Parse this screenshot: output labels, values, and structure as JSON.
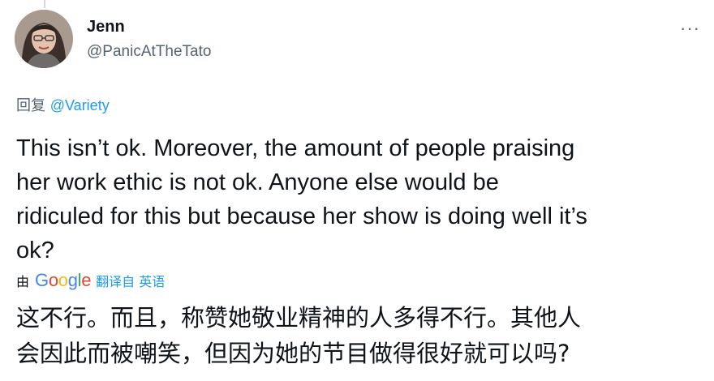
{
  "author": {
    "name": "Jenn",
    "handle": "@PanicAtTheTato",
    "avatar_icon": "profile-photo"
  },
  "more_icon": "···",
  "reply": {
    "prefix": "回复",
    "mention": "@Variety"
  },
  "tweet": {
    "text": "This isn’t ok. Moreover, the amount of people praising\nher work ethic is not ok. Anyone else would be\nridiculed for this but because her show is doing well it’s\nok?"
  },
  "translation": {
    "by_label": "由",
    "google": [
      "G",
      "o",
      "o",
      "g",
      "l",
      "e"
    ],
    "from_label": "翻译自 英语",
    "text": "这不行。而且，称赞她敬业精神的人多得不行。其他人\n会因此而被嘲笑，但因为她的节目做得很好就可以吗?"
  },
  "colors": {
    "link": "#1d9bf0",
    "secondary_text": "#536471",
    "primary_text": "#0f1419"
  }
}
